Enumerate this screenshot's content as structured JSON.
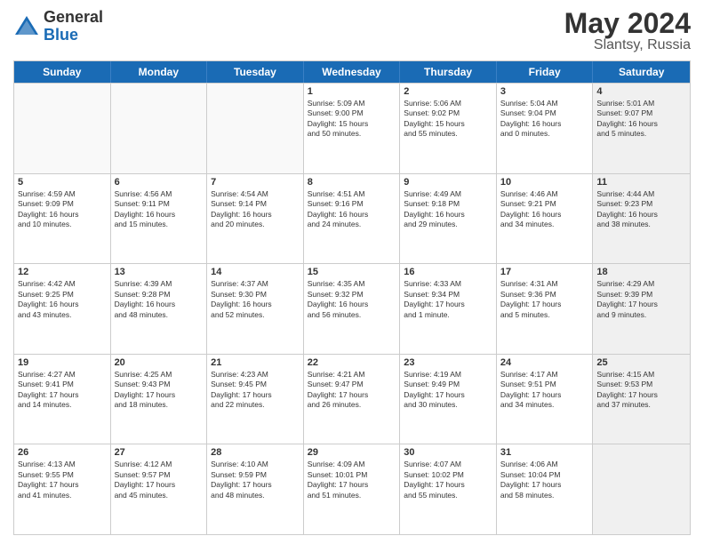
{
  "logo": {
    "general": "General",
    "blue": "Blue"
  },
  "title": {
    "month_year": "May 2024",
    "location": "Slantsy, Russia"
  },
  "header_days": [
    "Sunday",
    "Monday",
    "Tuesday",
    "Wednesday",
    "Thursday",
    "Friday",
    "Saturday"
  ],
  "weeks": [
    [
      {
        "day": "",
        "text": "",
        "empty": true
      },
      {
        "day": "",
        "text": "",
        "empty": true
      },
      {
        "day": "",
        "text": "",
        "empty": true
      },
      {
        "day": "1",
        "text": "Sunrise: 5:09 AM\nSunset: 9:00 PM\nDaylight: 15 hours\nand 50 minutes."
      },
      {
        "day": "2",
        "text": "Sunrise: 5:06 AM\nSunset: 9:02 PM\nDaylight: 15 hours\nand 55 minutes."
      },
      {
        "day": "3",
        "text": "Sunrise: 5:04 AM\nSunset: 9:04 PM\nDaylight: 16 hours\nand 0 minutes."
      },
      {
        "day": "4",
        "text": "Sunrise: 5:01 AM\nSunset: 9:07 PM\nDaylight: 16 hours\nand 5 minutes.",
        "shaded": true
      }
    ],
    [
      {
        "day": "5",
        "text": "Sunrise: 4:59 AM\nSunset: 9:09 PM\nDaylight: 16 hours\nand 10 minutes."
      },
      {
        "day": "6",
        "text": "Sunrise: 4:56 AM\nSunset: 9:11 PM\nDaylight: 16 hours\nand 15 minutes."
      },
      {
        "day": "7",
        "text": "Sunrise: 4:54 AM\nSunset: 9:14 PM\nDaylight: 16 hours\nand 20 minutes."
      },
      {
        "day": "8",
        "text": "Sunrise: 4:51 AM\nSunset: 9:16 PM\nDaylight: 16 hours\nand 24 minutes."
      },
      {
        "day": "9",
        "text": "Sunrise: 4:49 AM\nSunset: 9:18 PM\nDaylight: 16 hours\nand 29 minutes."
      },
      {
        "day": "10",
        "text": "Sunrise: 4:46 AM\nSunset: 9:21 PM\nDaylight: 16 hours\nand 34 minutes."
      },
      {
        "day": "11",
        "text": "Sunrise: 4:44 AM\nSunset: 9:23 PM\nDaylight: 16 hours\nand 38 minutes.",
        "shaded": true
      }
    ],
    [
      {
        "day": "12",
        "text": "Sunrise: 4:42 AM\nSunset: 9:25 PM\nDaylight: 16 hours\nand 43 minutes."
      },
      {
        "day": "13",
        "text": "Sunrise: 4:39 AM\nSunset: 9:28 PM\nDaylight: 16 hours\nand 48 minutes."
      },
      {
        "day": "14",
        "text": "Sunrise: 4:37 AM\nSunset: 9:30 PM\nDaylight: 16 hours\nand 52 minutes."
      },
      {
        "day": "15",
        "text": "Sunrise: 4:35 AM\nSunset: 9:32 PM\nDaylight: 16 hours\nand 56 minutes."
      },
      {
        "day": "16",
        "text": "Sunrise: 4:33 AM\nSunset: 9:34 PM\nDaylight: 17 hours\nand 1 minute."
      },
      {
        "day": "17",
        "text": "Sunrise: 4:31 AM\nSunset: 9:36 PM\nDaylight: 17 hours\nand 5 minutes."
      },
      {
        "day": "18",
        "text": "Sunrise: 4:29 AM\nSunset: 9:39 PM\nDaylight: 17 hours\nand 9 minutes.",
        "shaded": true
      }
    ],
    [
      {
        "day": "19",
        "text": "Sunrise: 4:27 AM\nSunset: 9:41 PM\nDaylight: 17 hours\nand 14 minutes."
      },
      {
        "day": "20",
        "text": "Sunrise: 4:25 AM\nSunset: 9:43 PM\nDaylight: 17 hours\nand 18 minutes."
      },
      {
        "day": "21",
        "text": "Sunrise: 4:23 AM\nSunset: 9:45 PM\nDaylight: 17 hours\nand 22 minutes."
      },
      {
        "day": "22",
        "text": "Sunrise: 4:21 AM\nSunset: 9:47 PM\nDaylight: 17 hours\nand 26 minutes."
      },
      {
        "day": "23",
        "text": "Sunrise: 4:19 AM\nSunset: 9:49 PM\nDaylight: 17 hours\nand 30 minutes."
      },
      {
        "day": "24",
        "text": "Sunrise: 4:17 AM\nSunset: 9:51 PM\nDaylight: 17 hours\nand 34 minutes."
      },
      {
        "day": "25",
        "text": "Sunrise: 4:15 AM\nSunset: 9:53 PM\nDaylight: 17 hours\nand 37 minutes.",
        "shaded": true
      }
    ],
    [
      {
        "day": "26",
        "text": "Sunrise: 4:13 AM\nSunset: 9:55 PM\nDaylight: 17 hours\nand 41 minutes."
      },
      {
        "day": "27",
        "text": "Sunrise: 4:12 AM\nSunset: 9:57 PM\nDaylight: 17 hours\nand 45 minutes."
      },
      {
        "day": "28",
        "text": "Sunrise: 4:10 AM\nSunset: 9:59 PM\nDaylight: 17 hours\nand 48 minutes."
      },
      {
        "day": "29",
        "text": "Sunrise: 4:09 AM\nSunset: 10:01 PM\nDaylight: 17 hours\nand 51 minutes."
      },
      {
        "day": "30",
        "text": "Sunrise: 4:07 AM\nSunset: 10:02 PM\nDaylight: 17 hours\nand 55 minutes."
      },
      {
        "day": "31",
        "text": "Sunrise: 4:06 AM\nSunset: 10:04 PM\nDaylight: 17 hours\nand 58 minutes."
      },
      {
        "day": "",
        "text": "",
        "empty": true,
        "shaded": true
      }
    ]
  ]
}
